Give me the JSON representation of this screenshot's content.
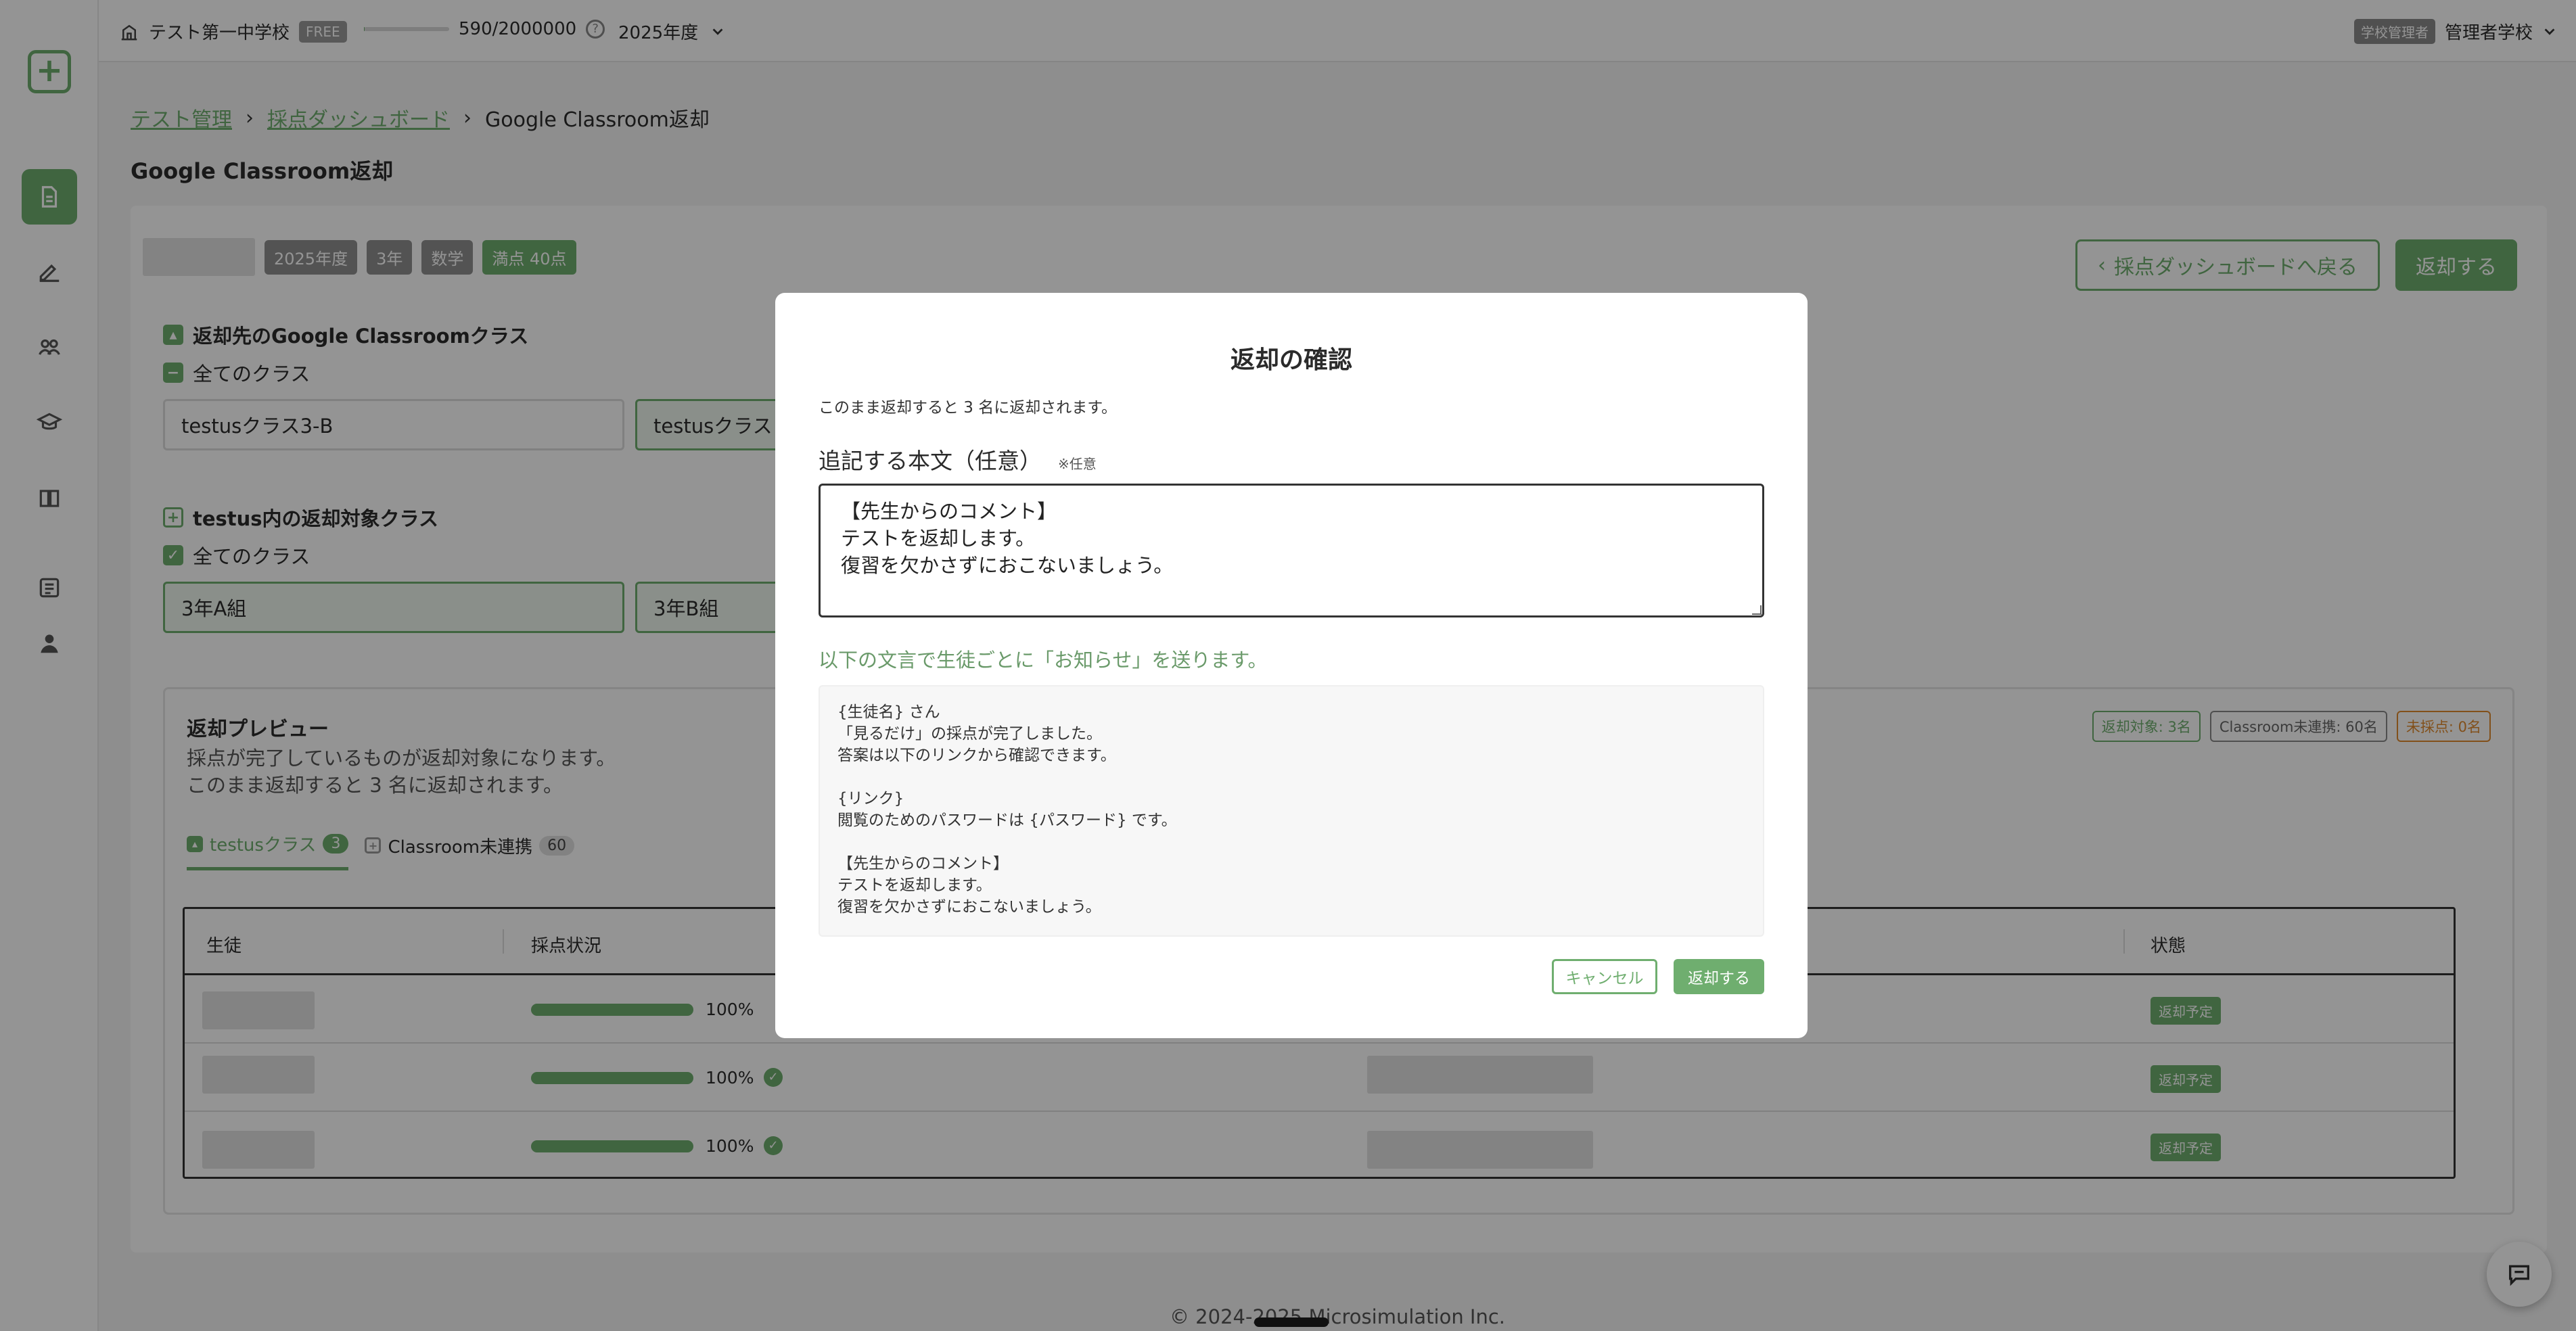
{
  "header": {
    "school_name": "テスト第一中学校",
    "plan_badge": "FREE",
    "usage_text": "590/2000000",
    "usage_ratio": 0.000295,
    "year": "2025年度",
    "role_badge": "学校管理者",
    "account_name": "管理者学校"
  },
  "breadcrumb": {
    "item1": "テスト管理",
    "item2": "採点ダッシュボード",
    "current": "Google Classroom返却"
  },
  "page": {
    "title": "Google Classroom返却",
    "tags": {
      "year": "2025年度",
      "grade": "3年",
      "subject": "数学",
      "full_score": "満点 40点"
    },
    "back_button": "採点ダッシュボードへ戻る",
    "return_button": "返却する"
  },
  "section_classroom": {
    "title": "返却先のGoogle Classroomクラス",
    "all_label": "全てのクラス",
    "classes": [
      "testusクラス3-B",
      "testusクラス"
    ]
  },
  "section_target": {
    "title": "testus内の返却対象クラス",
    "all_label": "全てのクラス",
    "classes": [
      "3年A組",
      "3年B組"
    ]
  },
  "preview": {
    "title": "返却プレビュー",
    "desc_line1": "採点が完了しているものが返却対象になります。",
    "desc_line2": "このまま返却すると 3 名に返却されます。",
    "badges": {
      "target": "返却対象: 3名",
      "unlinked": "Classroom未連携: 60名",
      "ungraded": "未採点: 0名"
    },
    "tabs": [
      {
        "label": "testusクラス",
        "count": "3"
      },
      {
        "label": "Classroom未連携",
        "count": "60"
      }
    ],
    "columns": {
      "student": "生徒",
      "status": "採点状況",
      "state": "状態"
    },
    "rows": [
      {
        "progress": "100%",
        "progress_value": 100,
        "state": "返却予定"
      },
      {
        "progress": "100%",
        "progress_value": 100,
        "state": "返却予定"
      },
      {
        "progress": "100%",
        "progress_value": 100,
        "state": "返却予定"
      }
    ]
  },
  "modal": {
    "title": "返却の確認",
    "intro": "このまま返却すると 3 名に返却されます。",
    "label": "追記する本文（任意）",
    "optional_note": "※任意",
    "textarea_value": "【先生からのコメント】\nテストを返却します。\n復習を欠かさずにおこないましょう。",
    "notice_note": "以下の文言で生徒ごとに「お知らせ」を送ります。",
    "notice_preview": "{生徒名} さん\n「見るだけ」の採点が完了しました。\n答案は以下のリンクから確認できます。\n\n{リンク}\n閲覧のためのパスワードは {パスワード} です。\n\n【先生からのコメント】\nテストを返却します。\n復習を欠かさずにおこないましょう。",
    "cancel_button": "キャンセル",
    "submit_button": "返却する"
  },
  "footer": {
    "copyright": "© 2024-2025 Microsimulation Inc."
  },
  "colors": {
    "accent": "#6fae6f",
    "warning": "#e08a2e",
    "overlay": "rgba(0,0,0,0.42)"
  }
}
